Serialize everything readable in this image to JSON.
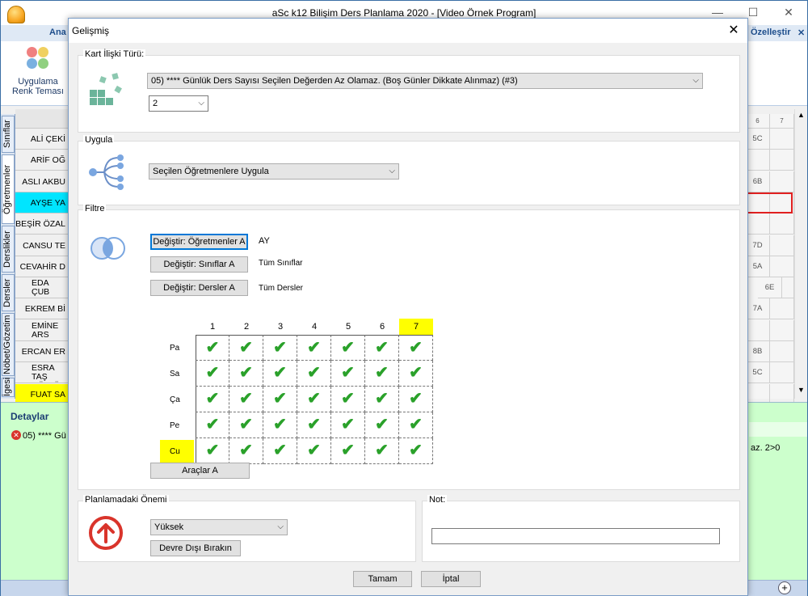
{
  "main": {
    "title": "aSc k12 Bilişim Ders Planlama 2020  - [Video Örnek Program]",
    "ribbon_tab_ana": "Ana",
    "ribbon_tab_right": "Özelleştir",
    "theme_button": "Uygulama\nRenk Teması",
    "side_tabs": [
      "Sınıflar",
      "Öğretmenler",
      "Derslikler",
      "Dersler",
      "Nöbet/Gözetim",
      "İgesi"
    ],
    "teachers": [
      "ALİ ÇEKİ",
      "ARİF OĞ",
      "ASLI AKBU",
      "AYŞE YA",
      "BEŞİR ÖZAL",
      "CANSU TE",
      "CEVAHİR D",
      "EDA ÇUB\nDURSUN",
      "EKREM Bİ",
      "EMİNE ARS\nKELEŞ",
      "ERCAN ER",
      "ESRA TAŞ\nGÜLLÜ",
      "FUAT SA"
    ],
    "right_headers": [
      "6",
      "7"
    ],
    "right_cells": [
      "5C",
      "",
      "6B",
      "",
      "",
      "7D",
      "5A",
      "6E",
      "7A",
      "",
      "8B",
      "5C",
      ""
    ],
    "details_title": "Detaylar",
    "details_msg": "05) **** Gü",
    "details_right": "az. 2>0"
  },
  "dialog": {
    "title": "Gelişmiş",
    "kart_caption": "Kart İlişki Türü:",
    "kart_value": "05) **** Günlük Ders Sayısı Seçilen Değerden Az Olamaz. (Boş Günler Dikkate Alınmaz) (#3)",
    "count_value": "2",
    "uygula_caption": "Uygula",
    "uygula_value": "Seçilen Öğretmenlere Uygula",
    "filtre_caption": "Filtre",
    "btn_ogretmen": "Değiştir: Öğretmenler A",
    "ogretmen_value": "AY",
    "btn_sinif": "Değiştir: Sınıflar A",
    "sinif_value": "Tüm Sınıflar",
    "btn_ders": "Değiştir: Dersler A",
    "ders_value": "Tüm Dersler",
    "periods": [
      "1",
      "2",
      "3",
      "4",
      "5",
      "6",
      "7"
    ],
    "days": [
      "Pa",
      "Sa",
      "Ça",
      "Pe",
      "Cu"
    ],
    "highlight_period": "7",
    "highlight_day": "Cu",
    "check_glyph": "✔",
    "btn_araclar": "Araçlar A",
    "onem_caption": "Planlamadaki Önemi",
    "onem_value": "Yüksek",
    "btn_devre": "Devre Dışı Bırakın",
    "not_caption": "Not:",
    "not_value": "",
    "btn_tamam": "Tamam",
    "btn_iptal": "İptal"
  },
  "colors": {
    "accent": "#0078d7",
    "check": "#2aa12a",
    "highlight": "#ffff00",
    "importance": "#d9342b",
    "details_bg": "#ccffcc"
  }
}
